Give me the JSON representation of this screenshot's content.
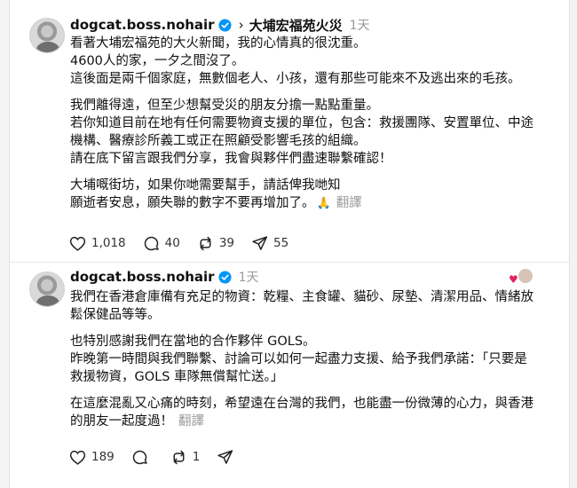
{
  "posts": [
    {
      "username": "dogcat.boss.nohair",
      "topic": "大埔宏福苑火災",
      "time": "1天",
      "paragraphs": [
        [
          "看著大埔宏福苑的大火新聞，我的心情真的很沈重。",
          "4600人的家，一夕之間沒了。",
          "這後面是兩千個家庭，無數個老人、小孩，還有那些可能來不及逃出來的毛孩。"
        ],
        [
          "我們離得遠，但至少想幫受災的朋友分擔一點點重量。",
          "若你知道目前在地有任何需要物資支援的單位，包含：救援團隊、安置單位、中途",
          "機構、醫療診所義工或正在照顧受影響毛孩的組織。",
          "請在底下留言跟我們分享，我會與夥伴們盡速聯繫確認！"
        ],
        [
          "大埔嘅街坊，如果你哋需要幫手，請話俾我哋知",
          "願逝者安息，願失聯的數字不要再增加了。"
        ]
      ],
      "pray_emoji": "🙏",
      "translate_label": "翻譯",
      "stats": {
        "likes": "1,018",
        "replies": "40",
        "reposts": "39",
        "shares": "55"
      }
    },
    {
      "username": "dogcat.boss.nohair",
      "time": "1天",
      "paragraphs": [
        [
          "我們在香港倉庫備有充足的物資：乾糧、主食罐、貓砂、尿墊、清潔用品、情緒放",
          "鬆保健品等等。"
        ],
        [
          "也特別感謝我們在當地的合作夥伴 GOLS。",
          "昨晚第一時間與我們聯繫、討論可以如何一起盡力支援、給予我們承諾：「只要是",
          "救援物資，GOLS 車隊無償幫忙送。」"
        ],
        [
          "在這麼混亂又心痛的時刻，希望遠在台灣的我們，也能盡一份微薄的心力，與香港",
          "的朋友一起度過！"
        ]
      ],
      "translate_label": "翻譯",
      "stats": {
        "likes": "189",
        "replies": "",
        "reposts": "1",
        "shares": ""
      }
    }
  ],
  "colors": {
    "verified": "#0095f6",
    "muted": "#999999",
    "text": "#101010"
  }
}
